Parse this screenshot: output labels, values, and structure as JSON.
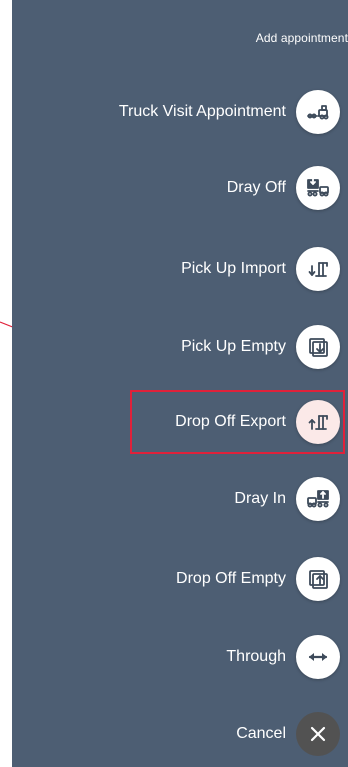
{
  "panel": {
    "title": "Add appointment"
  },
  "actions": [
    {
      "id": "truck-visit",
      "label": "Truck Visit Appointment",
      "icon": "truck-visit-icon"
    },
    {
      "id": "dray-off",
      "label": "Dray Off",
      "icon": "dray-off-icon"
    },
    {
      "id": "pick-up-import",
      "label": "Pick Up Import",
      "icon": "pick-up-import-icon"
    },
    {
      "id": "pick-up-empty",
      "label": "Pick Up Empty",
      "icon": "pick-up-empty-icon"
    },
    {
      "id": "drop-off-export",
      "label": "Drop Off Export",
      "icon": "drop-off-export-icon",
      "highlighted": true
    },
    {
      "id": "dray-in",
      "label": "Dray In",
      "icon": "dray-in-icon"
    },
    {
      "id": "drop-off-empty",
      "label": "Drop Off Empty",
      "icon": "drop-off-empty-icon"
    },
    {
      "id": "through",
      "label": "Through",
      "icon": "through-arrows-icon"
    },
    {
      "id": "cancel",
      "label": "Cancel",
      "icon": "close-icon"
    }
  ],
  "colors": {
    "panel_bg": "#4d5e73",
    "highlight_border": "#e0213a",
    "annotation_arrow": "#e0213a",
    "cancel_bg": "#525252"
  }
}
